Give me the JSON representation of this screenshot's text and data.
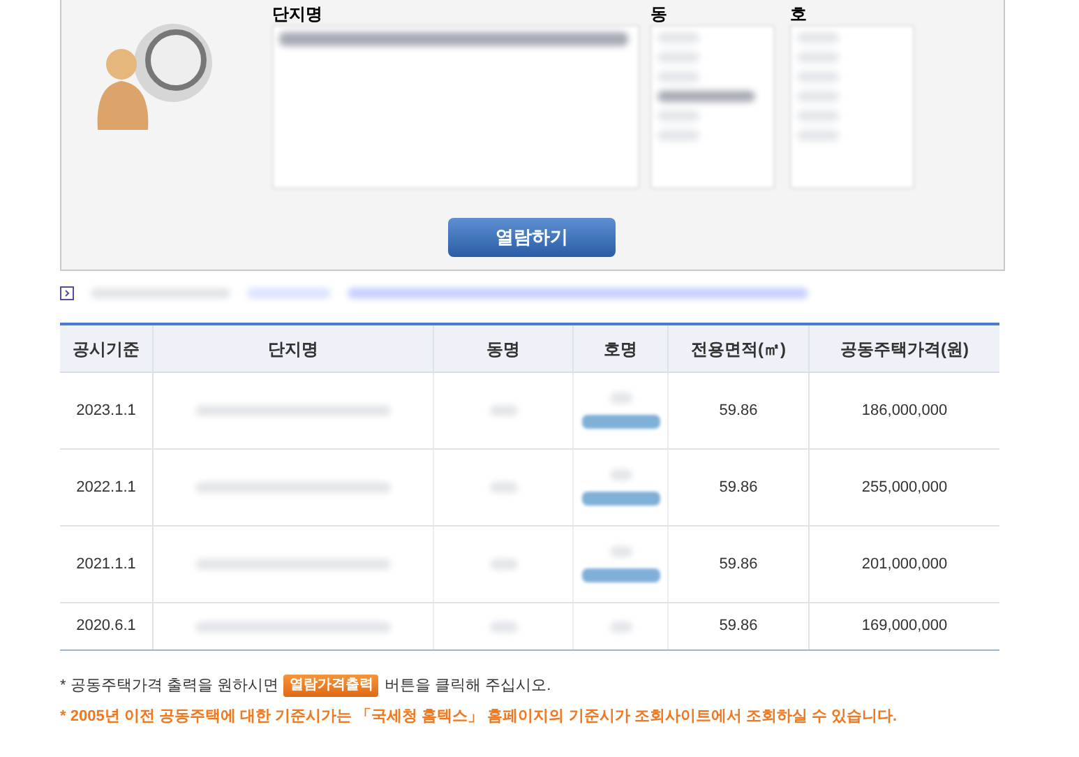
{
  "search_panel": {
    "labels": [
      {
        "text": "단지명"
      },
      {
        "text": "동"
      },
      {
        "text": "호"
      }
    ],
    "view_button": "열람하기"
  },
  "table": {
    "columns": [
      "공시기준",
      "단지명",
      "동명",
      "호명",
      "전용면적(㎡)",
      "공동주택가격(원)"
    ],
    "rows": [
      {
        "date": "2023.1.1",
        "area": "59.86",
        "price": "186,000,000",
        "has_button": true
      },
      {
        "date": "2022.1.1",
        "area": "59.86",
        "price": "255,000,000",
        "has_button": true
      },
      {
        "date": "2021.1.1",
        "area": "59.86",
        "price": "201,000,000",
        "has_button": true
      },
      {
        "date": "2020.6.1",
        "area": "59.86",
        "price": "169,000,000",
        "has_button": false
      }
    ]
  },
  "notes": {
    "before": "* 공동주택가격 출력을 원하시면",
    "button": "열람가격출력",
    "after": "버튼을 클릭해 주십시오.",
    "warning": "* 2005년 이전 공동주택에 대한 기준시가는 「국세청 홈텍스」 홈페이지의 기준시가 조회사이트에서 조회하실 수 있습니다."
  }
}
